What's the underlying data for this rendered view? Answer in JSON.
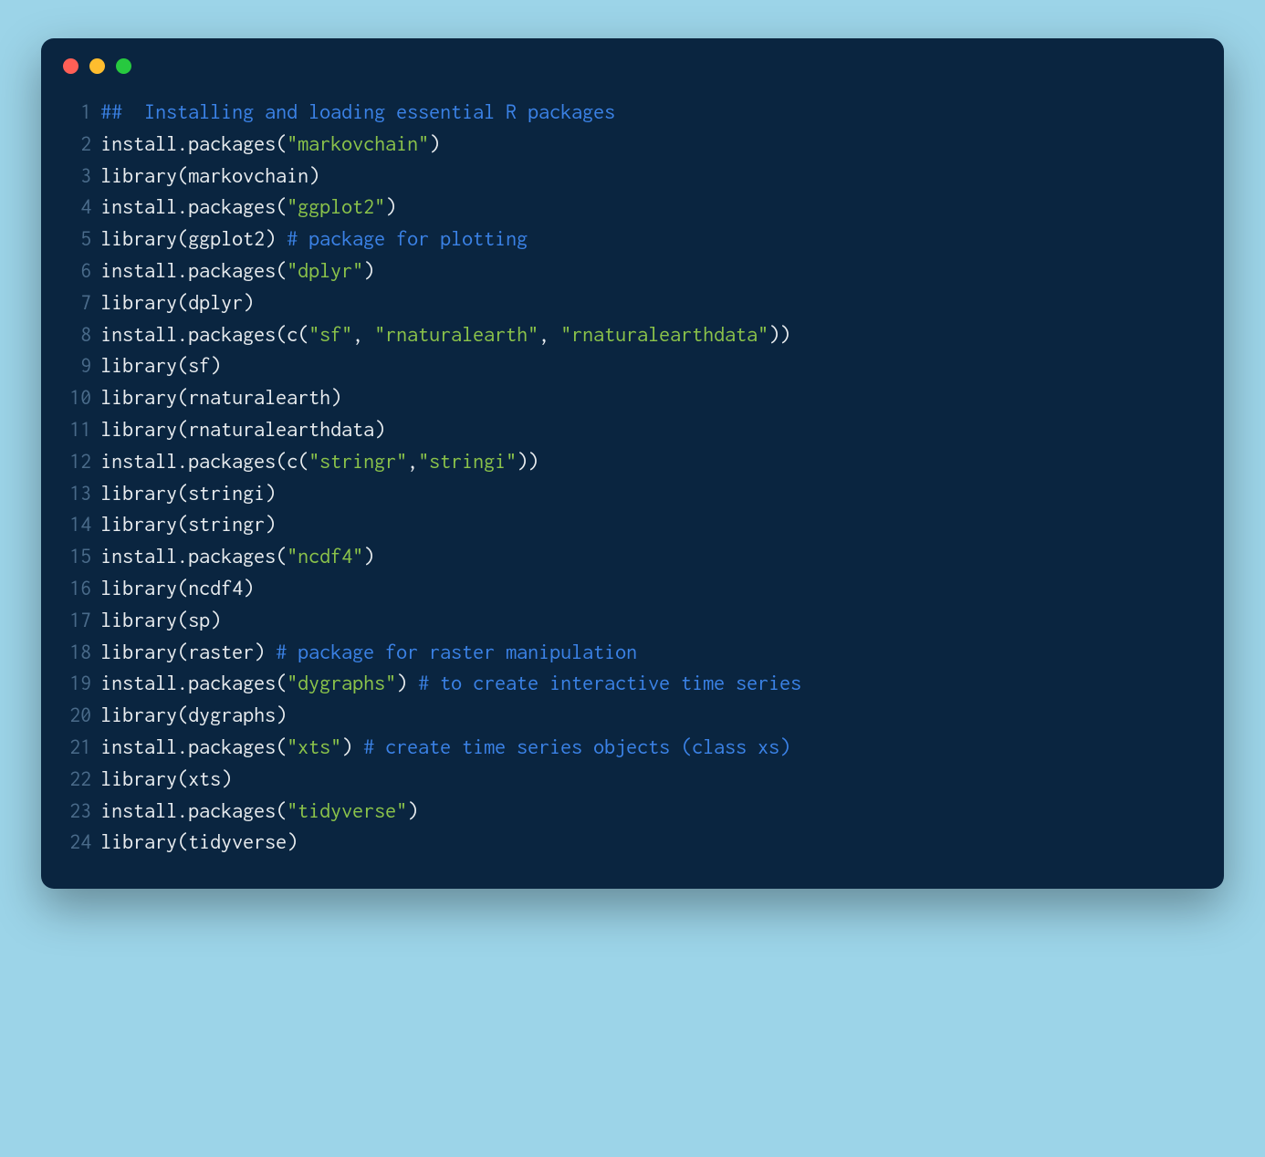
{
  "window": {
    "traffic_lights": [
      "close",
      "minimize",
      "zoom"
    ]
  },
  "colors": {
    "background": "#9cd4e8",
    "window_bg": "#0a2540",
    "comment": "#3b82e6",
    "string": "#8bc34a",
    "default": "#e8ecef",
    "lineno": "#4a6b8a"
  },
  "code": {
    "language": "r",
    "lines": [
      {
        "n": 1,
        "tokens": [
          {
            "t": "##  Installing and loading essential R packages",
            "c": "comment"
          }
        ]
      },
      {
        "n": 2,
        "tokens": [
          {
            "t": "install.packages",
            "c": "func"
          },
          {
            "t": "(",
            "c": "punct"
          },
          {
            "t": "\"markovchain\"",
            "c": "string"
          },
          {
            "t": ")",
            "c": "punct"
          }
        ]
      },
      {
        "n": 3,
        "tokens": [
          {
            "t": "library",
            "c": "func"
          },
          {
            "t": "(",
            "c": "punct"
          },
          {
            "t": "markovchain",
            "c": "ident"
          },
          {
            "t": ")",
            "c": "punct"
          }
        ]
      },
      {
        "n": 4,
        "tokens": [
          {
            "t": "install.packages",
            "c": "func"
          },
          {
            "t": "(",
            "c": "punct"
          },
          {
            "t": "\"ggplot2\"",
            "c": "string"
          },
          {
            "t": ")",
            "c": "punct"
          }
        ]
      },
      {
        "n": 5,
        "tokens": [
          {
            "t": "library",
            "c": "func"
          },
          {
            "t": "(",
            "c": "punct"
          },
          {
            "t": "ggplot2",
            "c": "ident"
          },
          {
            "t": ")",
            "c": "punct"
          },
          {
            "t": " ",
            "c": "punct"
          },
          {
            "t": "# package for plotting",
            "c": "comment"
          }
        ]
      },
      {
        "n": 6,
        "tokens": [
          {
            "t": "install.packages",
            "c": "func"
          },
          {
            "t": "(",
            "c": "punct"
          },
          {
            "t": "\"dplyr\"",
            "c": "string"
          },
          {
            "t": ")",
            "c": "punct"
          }
        ]
      },
      {
        "n": 7,
        "tokens": [
          {
            "t": "library",
            "c": "func"
          },
          {
            "t": "(",
            "c": "punct"
          },
          {
            "t": "dplyr",
            "c": "ident"
          },
          {
            "t": ")",
            "c": "punct"
          }
        ]
      },
      {
        "n": 8,
        "tokens": [
          {
            "t": "install.packages",
            "c": "func"
          },
          {
            "t": "(",
            "c": "punct"
          },
          {
            "t": "c",
            "c": "func"
          },
          {
            "t": "(",
            "c": "punct"
          },
          {
            "t": "\"sf\"",
            "c": "string"
          },
          {
            "t": ", ",
            "c": "punct"
          },
          {
            "t": "\"rnaturalearth\"",
            "c": "string"
          },
          {
            "t": ", ",
            "c": "punct"
          },
          {
            "t": "\"rnaturalearthdata\"",
            "c": "string"
          },
          {
            "t": "))",
            "c": "punct"
          }
        ]
      },
      {
        "n": 9,
        "tokens": [
          {
            "t": "library",
            "c": "func"
          },
          {
            "t": "(",
            "c": "punct"
          },
          {
            "t": "sf",
            "c": "ident"
          },
          {
            "t": ")",
            "c": "punct"
          }
        ]
      },
      {
        "n": 10,
        "tokens": [
          {
            "t": "library",
            "c": "func"
          },
          {
            "t": "(",
            "c": "punct"
          },
          {
            "t": "rnaturalearth",
            "c": "ident"
          },
          {
            "t": ")",
            "c": "punct"
          }
        ]
      },
      {
        "n": 11,
        "tokens": [
          {
            "t": "library",
            "c": "func"
          },
          {
            "t": "(",
            "c": "punct"
          },
          {
            "t": "rnaturalearthdata",
            "c": "ident"
          },
          {
            "t": ")",
            "c": "punct"
          }
        ]
      },
      {
        "n": 12,
        "tokens": [
          {
            "t": "install.packages",
            "c": "func"
          },
          {
            "t": "(",
            "c": "punct"
          },
          {
            "t": "c",
            "c": "func"
          },
          {
            "t": "(",
            "c": "punct"
          },
          {
            "t": "\"stringr\"",
            "c": "string"
          },
          {
            "t": ",",
            "c": "punct"
          },
          {
            "t": "\"stringi\"",
            "c": "string"
          },
          {
            "t": "))",
            "c": "punct"
          }
        ]
      },
      {
        "n": 13,
        "tokens": [
          {
            "t": "library",
            "c": "func"
          },
          {
            "t": "(",
            "c": "punct"
          },
          {
            "t": "stringi",
            "c": "ident"
          },
          {
            "t": ")",
            "c": "punct"
          }
        ]
      },
      {
        "n": 14,
        "tokens": [
          {
            "t": "library",
            "c": "func"
          },
          {
            "t": "(",
            "c": "punct"
          },
          {
            "t": "stringr",
            "c": "ident"
          },
          {
            "t": ")",
            "c": "punct"
          }
        ]
      },
      {
        "n": 15,
        "tokens": [
          {
            "t": "install.packages",
            "c": "func"
          },
          {
            "t": "(",
            "c": "punct"
          },
          {
            "t": "\"ncdf4\"",
            "c": "string"
          },
          {
            "t": ")",
            "c": "punct"
          }
        ]
      },
      {
        "n": 16,
        "tokens": [
          {
            "t": "library",
            "c": "func"
          },
          {
            "t": "(",
            "c": "punct"
          },
          {
            "t": "ncdf4",
            "c": "ident"
          },
          {
            "t": ")",
            "c": "punct"
          }
        ]
      },
      {
        "n": 17,
        "tokens": [
          {
            "t": "library",
            "c": "func"
          },
          {
            "t": "(",
            "c": "punct"
          },
          {
            "t": "sp",
            "c": "ident"
          },
          {
            "t": ")",
            "c": "punct"
          }
        ]
      },
      {
        "n": 18,
        "tokens": [
          {
            "t": "library",
            "c": "func"
          },
          {
            "t": "(",
            "c": "punct"
          },
          {
            "t": "raster",
            "c": "ident"
          },
          {
            "t": ")",
            "c": "punct"
          },
          {
            "t": " ",
            "c": "punct"
          },
          {
            "t": "# package for raster manipulation",
            "c": "comment"
          }
        ]
      },
      {
        "n": 19,
        "tokens": [
          {
            "t": "install.packages",
            "c": "func"
          },
          {
            "t": "(",
            "c": "punct"
          },
          {
            "t": "\"dygraphs\"",
            "c": "string"
          },
          {
            "t": ")",
            "c": "punct"
          },
          {
            "t": " ",
            "c": "punct"
          },
          {
            "t": "# to create interactive time series",
            "c": "comment"
          }
        ]
      },
      {
        "n": 20,
        "tokens": [
          {
            "t": "library",
            "c": "func"
          },
          {
            "t": "(",
            "c": "punct"
          },
          {
            "t": "dygraphs",
            "c": "ident"
          },
          {
            "t": ")",
            "c": "punct"
          }
        ]
      },
      {
        "n": 21,
        "tokens": [
          {
            "t": "install.packages",
            "c": "func"
          },
          {
            "t": "(",
            "c": "punct"
          },
          {
            "t": "\"xts\"",
            "c": "string"
          },
          {
            "t": ")",
            "c": "punct"
          },
          {
            "t": " ",
            "c": "punct"
          },
          {
            "t": "# create time series objects (class xs)",
            "c": "comment"
          }
        ]
      },
      {
        "n": 22,
        "tokens": [
          {
            "t": "library",
            "c": "func"
          },
          {
            "t": "(",
            "c": "punct"
          },
          {
            "t": "xts",
            "c": "ident"
          },
          {
            "t": ")",
            "c": "punct"
          }
        ]
      },
      {
        "n": 23,
        "tokens": [
          {
            "t": "install.packages",
            "c": "func"
          },
          {
            "t": "(",
            "c": "punct"
          },
          {
            "t": "\"tidyverse\"",
            "c": "string"
          },
          {
            "t": ")",
            "c": "punct"
          }
        ]
      },
      {
        "n": 24,
        "tokens": [
          {
            "t": "library",
            "c": "func"
          },
          {
            "t": "(",
            "c": "punct"
          },
          {
            "t": "tidyverse",
            "c": "ident"
          },
          {
            "t": ")",
            "c": "punct"
          }
        ]
      }
    ]
  }
}
